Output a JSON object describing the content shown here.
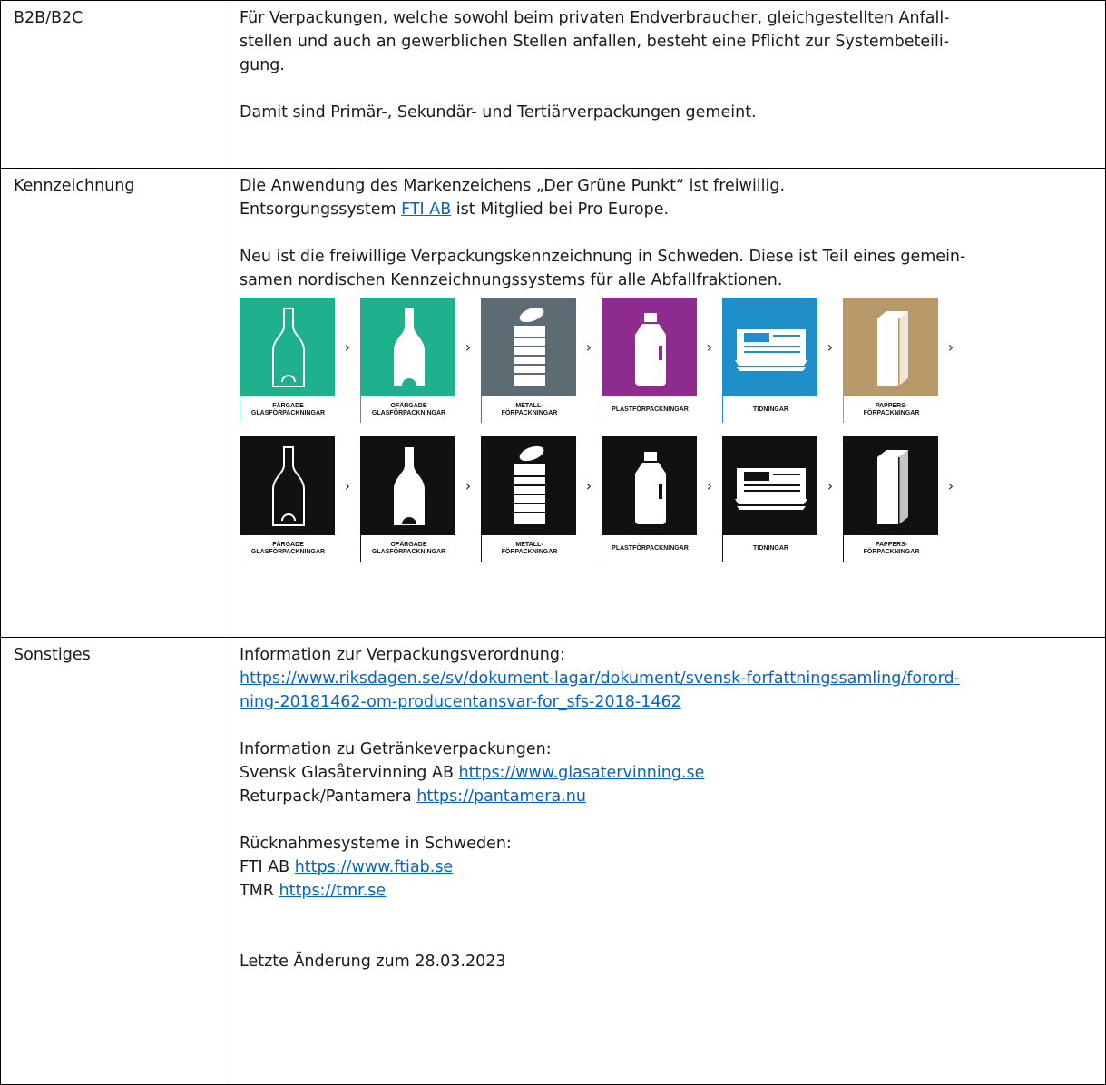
{
  "rows": {
    "b2b": {
      "label": "B2B/B2C",
      "lines": [
        "Für Verpackungen, welche sowohl beim privaten Endverbraucher, gleichgestellten Anfall-",
        "stellen und auch an gewerblichen Stellen anfallen, besteht eine Pflicht zur Systembeteili-",
        "gung."
      ],
      "line2": "Damit sind Primär-, Sekundär- und Tertiärverpackungen gemeint."
    },
    "kennzeichnung": {
      "label": "Kennzeichnung",
      "line1": "Die Anwendung des Markenzeichens „Der Grüne Punkt“ ist freiwillig.",
      "line2_pre": "Entsorgungssystem ",
      "line2_link": "FTI AB",
      "line2_post": " ist Mitglied bei Pro Europe.",
      "para2": [
        "Neu ist die freiwillige Verpackungskennzeichnung in Schweden. Diese ist Teil eines gemein-",
        "samen nordischen Kennzeichnungssystems für alle Abfallfraktionen."
      ],
      "arrow": "›",
      "icons": [
        {
          "caption": "FÄRGADE\nGLASFÖRPACKNINGAR",
          "color": "#1fb18e",
          "icon": "bottle-outline-icon"
        },
        {
          "caption": "OFÄRGADE\nGLASFÖRPACKNINGAR",
          "color": "#1fb18e",
          "icon": "bottle-filled-icon"
        },
        {
          "caption": "METALL-\nFÖRPACKNINGAR",
          "color": "#5d6b73",
          "icon": "can-icon"
        },
        {
          "caption": "PLASTFÖRPACKNINGAR",
          "color": "#8e2b8f",
          "icon": "plastic-bottle-icon"
        },
        {
          "caption": "TIDNINGAR",
          "color": "#1e8fc8",
          "icon": "newspaper-icon"
        },
        {
          "caption": "PAPPERS-\nFÖRPACKNINGAR",
          "color": "#b89a6a",
          "icon": "carton-icon"
        }
      ],
      "dark_color": "#111111"
    },
    "sonstiges": {
      "label": "Sonstiges",
      "info_title": "Information zur Verpackungsverordnung:",
      "info_link_lines": [
        "https://www.riksdagen.se/sv/dokument-lagar/dokument/svensk-forfattningssamling/forord-",
        "ning-20181462-om-producentansvar-for_sfs-2018-1462"
      ],
      "drinks_title": "Information zu Getränkeverpackungen:",
      "glas_pre": "Svensk Glasåtervinning AB ",
      "glas_link": "https://www.glasatervinning.se",
      "pant_pre": "Returpack/Pantamera ",
      "pant_link": "https://pantamera.nu",
      "systems_title": "Rücknahmesysteme in Schweden:",
      "fti_pre": "FTI AB ",
      "fti_link": "https://www.ftiab.se",
      "tmr_pre": "TMR ",
      "tmr_link": "https://tmr.se",
      "updated": "Letzte Änderung zum 28.03.2023"
    }
  },
  "colors": {
    "link": "#0563C1",
    "border": "#000000"
  }
}
